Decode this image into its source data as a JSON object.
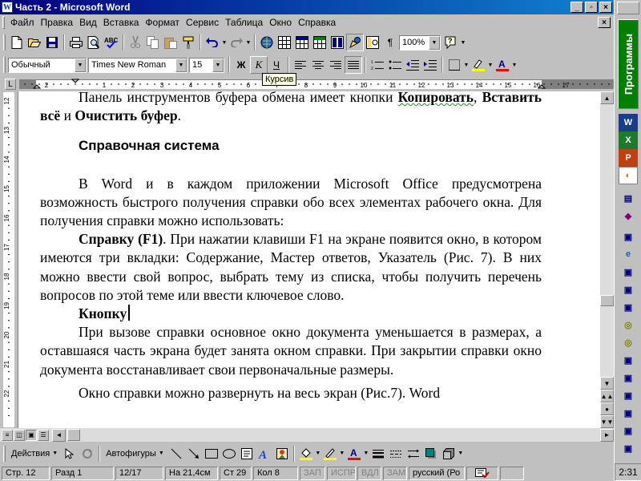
{
  "window": {
    "title": "Часть 2 - Microsoft Word",
    "app_icon": "word-icon",
    "controls": [
      "_",
      "▫",
      "×"
    ]
  },
  "menu": {
    "items": [
      "Файл",
      "Правка",
      "Вид",
      "Вставка",
      "Формат",
      "Сервис",
      "Таблица",
      "Окно",
      "Справка"
    ],
    "doc_controls": [
      "×"
    ]
  },
  "standard_toolbar": {
    "zoom": "100%",
    "icons": [
      "new-icon",
      "open-icon",
      "save-icon",
      "print-icon",
      "preview-icon",
      "spelling-icon",
      "cut-icon",
      "copy-icon",
      "paste-icon",
      "format-painter-icon",
      "undo-icon",
      "redo-icon",
      "hyperlink-icon",
      "tables-borders-icon",
      "insert-table-icon",
      "insert-excel-icon",
      "columns-icon",
      "drawing-icon",
      "document-map-icon",
      "show-paragraph-icon",
      "help-icon"
    ],
    "paragraph_mark": "¶"
  },
  "formatting_toolbar": {
    "style": "Обычный",
    "font": "Times New Roman",
    "size": "15",
    "bold": "Ж",
    "italic": "К",
    "underline": "Ч",
    "highlight_color": "#ffff00",
    "font_color": "#ff0000"
  },
  "tooltip": {
    "text": "Курсив"
  },
  "ruler": {
    "h_labels": [
      "1",
      "2",
      "1",
      "2",
      "3",
      "4",
      "5",
      "6",
      "7",
      "8",
      "9",
      "10",
      "11",
      "12",
      "13",
      "14",
      "15",
      "16",
      "17"
    ],
    "v_labels": [
      "12",
      "13",
      "14",
      "15",
      "16",
      "17",
      "18",
      "19",
      "20",
      "21",
      "22"
    ]
  },
  "document": {
    "p1": {
      "text": "Панель инструментов буфера обмена имеет кнопки ",
      "bold1": "Копировать",
      "comma": ",",
      "bold2": "Вставить всё",
      "and": " и ",
      "bold3": "Очистить буфер",
      "end": "."
    },
    "heading": "Справочная система",
    "p2": "В Word и в каждом приложении Microsoft Office предусмотрена возможность быстрого получения справки обо всех элементах рабочего окна. Для получения справки можно использовать:",
    "p3": {
      "bold": "Справку (F1)",
      "text": ". При нажатии клавиши F1 на экране появится окно, в котором имеются три вкладки: Содержание, Мастер ответов, Указатель (Рис. 7). В них можно ввести свой вопрос,  выбрать тему из списка, чтобы получить перечень вопросов по этой теме или ввести ключевое слово."
    },
    "p4": {
      "bold": "Кнопку"
    },
    "p5": "При вызове справки основное окно документа уменьшается в размерах, а оставшаяся часть экрана будет занята окном справки. При закрытии справки окно документа восстанавливает свои первоначальные размеры.",
    "p6": "Окно справки можно развернуть на весь экран (Рис.7). Word"
  },
  "drawing_toolbar": {
    "actions": "Действия",
    "autoshapes": "Автофигуры",
    "fill_color": "#ffff00",
    "line_color": "#ffff00",
    "font_color": "#ff0000",
    "font_glyph": "A"
  },
  "statusbar": {
    "page": "Стр. 12",
    "section": "Разд 1",
    "pages": "12/17",
    "position": "На 21,4см",
    "line": "Ст 29",
    "column": "Кол 8",
    "rec": "ЗАП",
    "trk": "ИСПР",
    "ext": "ВДЛ",
    "ovr": "ЗАМ",
    "language": "русский (Ро"
  },
  "office_bar": {
    "programs_label": "Программы",
    "clock": "2:31"
  }
}
